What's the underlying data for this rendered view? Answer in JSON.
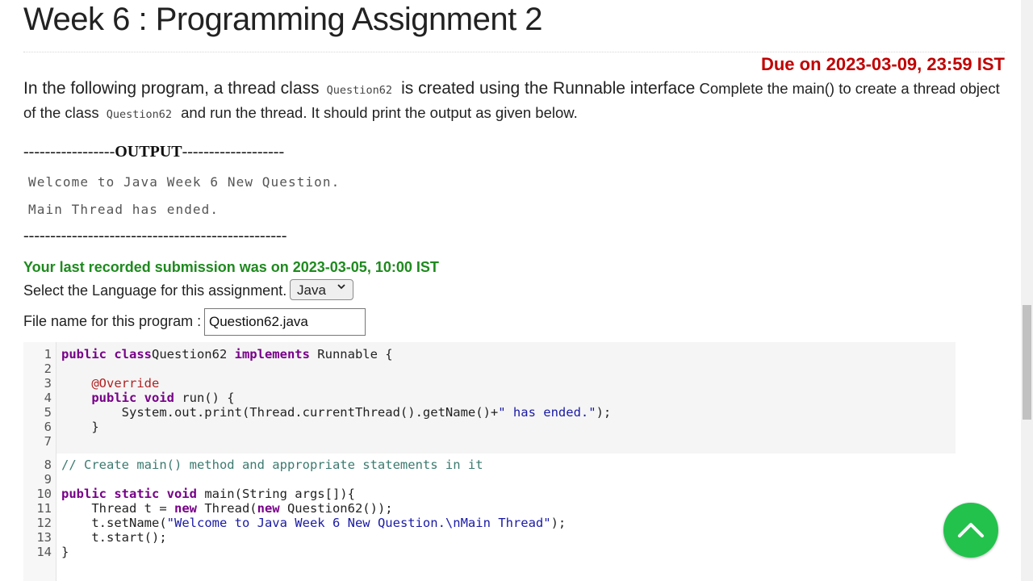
{
  "assignment": {
    "title": "Week 6 : Programming Assignment 2",
    "due": "Due on 2023-03-09, 23:59 IST"
  },
  "description": {
    "part1": "In the following program, a thread class",
    "class_name_1": "Question62",
    "part2": "is created using the Runnable interface",
    "part3": "Complete the main() to create a thread object of the class",
    "class_name_2": "Question62",
    "part4": "and run the thread. It should print the output as given below."
  },
  "output_block": {
    "header_left": "-----------------",
    "header_word": "OUTPUT",
    "header_right": "-------------------",
    "lines": [
      "Welcome to Java Week 6 New Question.",
      "Main Thread has ended."
    ],
    "footer": "-------------------------------------------------"
  },
  "submission": {
    "last_recorded": "Your last recorded submission was on 2023-03-05, 10:00 IST"
  },
  "language": {
    "label": "Select the Language for this assignment.",
    "selected": "Java"
  },
  "file": {
    "label": "File name for this program :",
    "value": "Question62.java"
  },
  "code_lines": [
    {
      "n": "1",
      "segments": [
        [
          "kw",
          "public class"
        ],
        [
          "",
          "Question62 "
        ],
        [
          "kw",
          "implements"
        ],
        [
          "",
          " Runnable {"
        ]
      ]
    },
    {
      "n": "2",
      "segments": []
    },
    {
      "n": "3",
      "segments": [
        [
          "",
          "    "
        ],
        [
          "ann",
          "@Override"
        ]
      ]
    },
    {
      "n": "4",
      "segments": [
        [
          "",
          "    "
        ],
        [
          "kw",
          "public void"
        ],
        [
          "",
          " run() {"
        ]
      ]
    },
    {
      "n": "5",
      "segments": [
        [
          "",
          "        System.out.print(Thread.currentThread().getName()+"
        ],
        [
          "str",
          "\" has ended.\""
        ],
        [
          "",
          ");"
        ]
      ]
    },
    {
      "n": "6",
      "segments": [
        [
          "",
          "    }"
        ]
      ]
    },
    {
      "n": "7",
      "segments": []
    },
    {
      "n": "8",
      "segments": [
        [
          "cmt",
          "// Create main() method and appropriate statements in it"
        ]
      ]
    },
    {
      "n": "9",
      "segments": []
    },
    {
      "n": "10",
      "segments": [
        [
          "kw",
          "public static void"
        ],
        [
          "",
          " main(String args[]){"
        ]
      ]
    },
    {
      "n": "11",
      "segments": [
        [
          "",
          "    Thread t = "
        ],
        [
          "kw",
          "new"
        ],
        [
          "",
          " Thread("
        ],
        [
          "kw",
          "new"
        ],
        [
          "",
          " Question62());"
        ]
      ]
    },
    {
      "n": "12",
      "segments": [
        [
          "",
          "    t.setName("
        ],
        [
          "str",
          "\"Welcome to Java Week 6 New Question.\\nMain Thread\""
        ],
        [
          "",
          ");"
        ]
      ]
    },
    {
      "n": "13",
      "segments": [
        [
          "",
          "    t.start();"
        ]
      ]
    },
    {
      "n": "14",
      "segments": [
        [
          "",
          "}"
        ]
      ]
    }
  ],
  "icons": {
    "scroll_to_top": "chevron-up-icon",
    "select_caret": "chevron-down-icon"
  },
  "colors": {
    "due": "#c00000",
    "submission": "#1e8a1e",
    "scroll_button": "#23c24d"
  }
}
